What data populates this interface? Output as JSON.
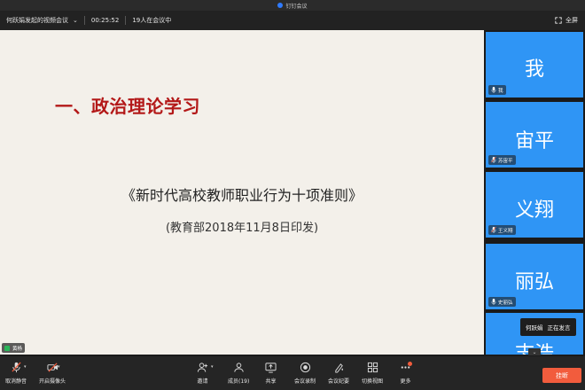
{
  "window": {
    "title": "钉钉会议"
  },
  "meeting": {
    "name": "何跃娟发起的视频会议",
    "duration": "00:25:52",
    "participants_text": "19人在会议中",
    "fullscreen_label": "全屏"
  },
  "slide": {
    "title": "一、政治理论学习",
    "document": "《新时代高校教师职业行为十项准则》",
    "subtitle": "(教育部2018年11月8日印发)",
    "speaker_tag": "黄杨"
  },
  "tiles": [
    {
      "name": "我",
      "tag": "我"
    },
    {
      "name": "宙平",
      "tag": "苏宙平"
    },
    {
      "name": "义翔",
      "tag": "王义翔"
    },
    {
      "name": "丽弘",
      "tag": "史丽弘"
    },
    {
      "name": "志浩",
      "tag": ""
    }
  ],
  "speaking": {
    "name": "何跃娟",
    "status": "正在发言"
  },
  "toolbar": {
    "mute_label": "取消静音",
    "camera_label": "开启摄像头",
    "invite_label": "邀请",
    "members_label": "成员(19)",
    "share_label": "共享",
    "record_label": "会议录制",
    "minutes_label": "会议纪要",
    "switch_view_label": "切换视图",
    "more_label": "更多",
    "leave_label": "挂断"
  },
  "colors": {
    "tile_blue": "#2f95f5",
    "slide_title_red": "#b31818",
    "leave_orange": "#f25c3d",
    "slide_bg": "#f3f0ea"
  }
}
